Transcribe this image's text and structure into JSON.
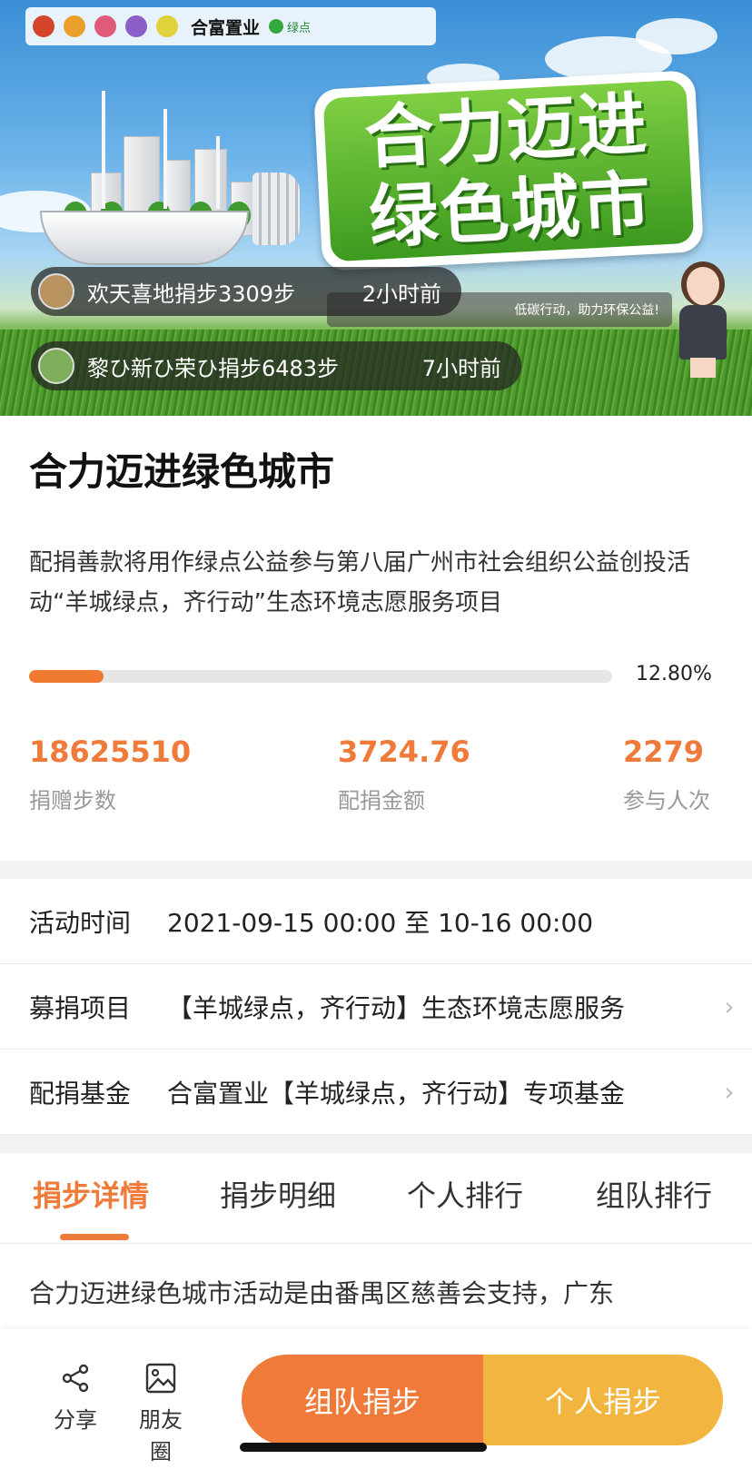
{
  "banner": {
    "logo_text": "合富置业",
    "logo_green": "绿点",
    "slogan_line1": "合力迈进",
    "slogan_line2": "绿色城市",
    "strip_text": "低碳行动，助力环保公益!",
    "tickers": [
      {
        "name": "欢天喜地捐步3309步",
        "time": "2小时前"
      },
      {
        "name": "黎ひ新ひ荣ひ捐步6483步",
        "time": "7小时前"
      }
    ]
  },
  "campaign": {
    "title": "合力迈进绿色城市",
    "description": "配捐善款将用作绿点公益参与第八届广州市社会组织公益创投活动“羊城绿点，齐行动”生态环境志愿服务项目",
    "progress_percent": 12.8,
    "progress_label": "12.80%",
    "stats": [
      {
        "value": "18625510",
        "label": "捐赠步数"
      },
      {
        "value": "3724.76",
        "label": "配捐金额"
      },
      {
        "value": "2279",
        "label": "参与人次"
      }
    ]
  },
  "details": {
    "time_key": "活动时间",
    "time_value": "2021-09-15 00:00 至 10-16 00:00",
    "project_key": "募捐项目",
    "project_value": "【羊城绿点，齐行动】生态环境志愿服务",
    "fund_key": "配捐基金",
    "fund_value": "合富置业【羊城绿点，齐行动】专项基金"
  },
  "tabs": [
    "捐步详情",
    "捐步明细",
    "个人排行",
    "组队排行"
  ],
  "body_text": "合力迈进绿色城市活动是由番禺区慈善会支持，广东",
  "bottom": {
    "share_label": "分享",
    "moments_label": "朋友圈",
    "team_button": "组队捐步",
    "personal_button": "个人捐步"
  },
  "colors": {
    "accent": "#ef7a39",
    "secondary": "#f2b540",
    "green": "#3c9a1f"
  }
}
